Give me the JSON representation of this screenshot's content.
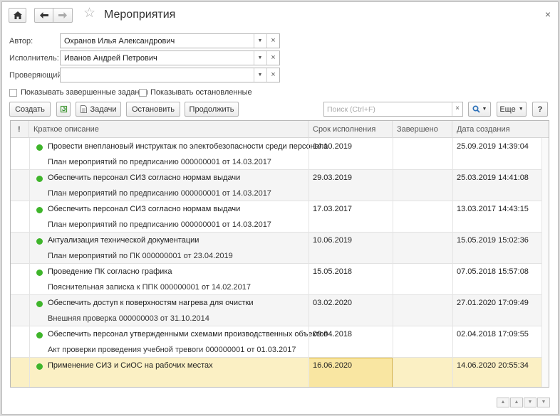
{
  "window": {
    "title": "Мероприятия",
    "close": "×"
  },
  "nav": {
    "home_icon": "home-icon",
    "back_icon": "arrow-left-icon",
    "forward_icon": "arrow-right-icon",
    "favorite_icon": "star-icon"
  },
  "form": {
    "author_label": "Автор:",
    "author_value": "Охранов Илья Александрович",
    "executor_label": "Исполнитель:",
    "executor_value": "Иванов Андрей Петрович",
    "checker_label": "Проверяющий:",
    "checker_value": "",
    "show_completed": "Показывать завершенные задания",
    "show_stopped": "Показывать остановленные"
  },
  "toolbar": {
    "create": "Создать",
    "tasks": "Задачи",
    "stop": "Остановить",
    "continue": "Продолжить",
    "search_placeholder": "Поиск (Ctrl+F)",
    "more": "Еще",
    "help": "?"
  },
  "table": {
    "columns": [
      "!",
      "Краткое описание",
      "Срок исполнения",
      "Завершено",
      "Дата создания"
    ],
    "rows": [
      {
        "title": "Провести внеплановый инструктаж по электобезопасности среди персонала",
        "basis": "План мероприятий по предписанию 000000001 от 14.03.2017",
        "due": "14.10.2019",
        "done": "",
        "created": "25.09.2019 14:39:04"
      },
      {
        "title": "Обеспечить персонал СИЗ согласно нормам выдачи",
        "basis": "План мероприятий по предписанию 000000001 от 14.03.2017",
        "due": "29.03.2019",
        "done": "",
        "created": "25.03.2019 14:41:08"
      },
      {
        "title": "Обеспечить персонал СИЗ согласно нормам выдачи",
        "basis": "План мероприятий по предписанию 000000001 от 14.03.2017",
        "due": "17.03.2017",
        "done": "",
        "created": "13.03.2017 14:43:15"
      },
      {
        "title": "Актуализация технической документации",
        "basis": "План мероприятий по ПК 000000001 от 23.04.2019",
        "due": "10.06.2019",
        "done": "",
        "created": "15.05.2019 15:02:36"
      },
      {
        "title": "Проведение ПК согласно графика",
        "basis": "Пояснительная записка к ППК 000000001 от 14.02.2017",
        "due": "15.05.2018",
        "done": "",
        "created": "07.05.2018 15:57:08"
      },
      {
        "title": "Обеспечить доступ к поверхностям нагрева для очистки",
        "basis": "Внешняя проверка 000000003 от 31.10.2014",
        "due": "03.02.2020",
        "done": "",
        "created": "27.01.2020 17:09:49"
      },
      {
        "title": "Обеспечить персонал утвержденными схемами производственных объектов ...",
        "basis": "Акт проверки проведения учебной тревоги 000000001 от 01.03.2017",
        "due": "09.04.2018",
        "done": "",
        "created": "02.04.2018 17:09:55"
      },
      {
        "title": "Применение СИЗ и СиОС на рабочих местах",
        "basis": "",
        "due": "16.06.2020",
        "done": "",
        "created": "14.06.2020 20:55:34"
      }
    ]
  },
  "colors": {
    "status_dot": "#3fb52b",
    "selected_row": "#fbf0c4",
    "selected_cell": "#f9e6a2"
  }
}
